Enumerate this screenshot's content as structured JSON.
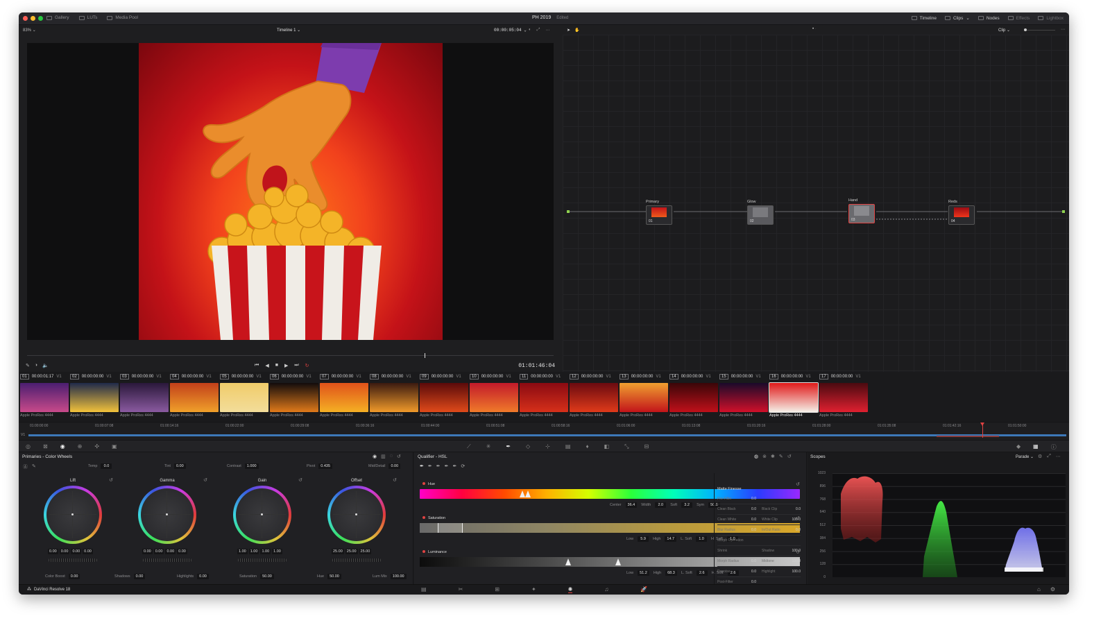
{
  "titlebar": {
    "left_items": [
      "Gallery",
      "LUTs",
      "Media Pool"
    ],
    "project_title": "PH 2019",
    "project_status": "Edited",
    "right_items": [
      {
        "label": "Timeline",
        "active": true
      },
      {
        "label": "Clips",
        "active": true
      },
      {
        "label": "Nodes",
        "active": true
      },
      {
        "label": "Effects",
        "active": false
      },
      {
        "label": "Lightbox",
        "active": false
      }
    ]
  },
  "viewer": {
    "zoom": "83%",
    "timeline_name": "Timeline 1",
    "source_timecode": "00:00:05:04",
    "record_timecode": "01:01:46:04"
  },
  "nodes_panel": {
    "mode": "Clip",
    "nodes": [
      {
        "label": "Primary",
        "num": "01"
      },
      {
        "label": "Glow",
        "num": "02"
      },
      {
        "label": "Hand",
        "num": "03"
      },
      {
        "label": "Reds",
        "num": "04"
      }
    ]
  },
  "clips": {
    "items": [
      {
        "num": "01",
        "tc": "00:00:01:17",
        "track": "V1",
        "label": "Apple ProRes 4444"
      },
      {
        "num": "02",
        "tc": "00:00:00:00",
        "track": "V1",
        "label": "Apple ProRes 4444"
      },
      {
        "num": "03",
        "tc": "00:00:00:00",
        "track": "V1",
        "label": "Apple ProRes 4444"
      },
      {
        "num": "04",
        "tc": "00:00:00:00",
        "track": "V1",
        "label": "Apple ProRes 4444"
      },
      {
        "num": "05",
        "tc": "00:00:00:00",
        "track": "V1",
        "label": "Apple ProRes 4444"
      },
      {
        "num": "06",
        "tc": "00:00:00:00",
        "track": "V1",
        "label": "Apple ProRes 4444"
      },
      {
        "num": "07",
        "tc": "00:00:00:00",
        "track": "V1",
        "label": "Apple ProRes 4444"
      },
      {
        "num": "08",
        "tc": "00:00:00:00",
        "track": "V1",
        "label": "Apple ProRes 4444"
      },
      {
        "num": "09",
        "tc": "00:00:00:00",
        "track": "V1",
        "label": "Apple ProRes 4444"
      },
      {
        "num": "10",
        "tc": "00:00:00:00",
        "track": "V1",
        "label": "Apple ProRes 4444"
      },
      {
        "num": "11",
        "tc": "00:00:00:00",
        "track": "V1",
        "label": "Apple ProRes 4444"
      },
      {
        "num": "12",
        "tc": "00:00:00:00",
        "track": "V1",
        "label": "Apple ProRes 4444"
      },
      {
        "num": "13",
        "tc": "00:00:00:00",
        "track": "V1",
        "label": "Apple ProRes 4444"
      },
      {
        "num": "14",
        "tc": "00:00:00:00",
        "track": "V1",
        "label": "Apple ProRes 4444"
      },
      {
        "num": "15",
        "tc": "00:00:00:00",
        "track": "V1",
        "label": "Apple ProRes 4444"
      },
      {
        "num": "16",
        "tc": "00:00:00:00",
        "track": "V1",
        "label": "Apple ProRes 4444"
      },
      {
        "num": "17",
        "tc": "00:00:00:00",
        "track": "V1",
        "label": "Apple ProRes 4444"
      }
    ],
    "track_label": "V1",
    "ruler_ticks": [
      "01:00:00:00",
      "01:00:07:08",
      "01:00:14:16",
      "01:00:22:00",
      "01:00:29:08",
      "01:00:36:16",
      "01:00:44:00",
      "01:00:51:08",
      "01:00:58:16",
      "01:01:06:00",
      "01:01:13:08",
      "01:01:20:16",
      "01:01:28:00",
      "01:01:35:08",
      "01:01:42:16",
      "01:01:50:00"
    ]
  },
  "primaries": {
    "title": "Primaries - Color Wheels",
    "top_params": [
      {
        "label": "Temp",
        "value": "0.0"
      },
      {
        "label": "Tint",
        "value": "0.00"
      },
      {
        "label": "Contrast",
        "value": "1.000"
      },
      {
        "label": "Pivot",
        "value": "0.435"
      },
      {
        "label": "Mid/Detail",
        "value": "0.00"
      }
    ],
    "wheels": [
      {
        "name": "Lift",
        "values": [
          "0.00",
          "0.00",
          "0.00",
          "0.00"
        ]
      },
      {
        "name": "Gamma",
        "values": [
          "0.00",
          "0.00",
          "0.00",
          "0.00"
        ]
      },
      {
        "name": "Gain",
        "values": [
          "1.00",
          "1.00",
          "1.00",
          "1.00"
        ]
      },
      {
        "name": "Offset",
        "values": [
          "25.00",
          "25.00",
          "25.00"
        ]
      }
    ],
    "bottom_params": [
      {
        "label": "Color Boost",
        "value": "0.00"
      },
      {
        "label": "Shadows",
        "value": "0.00"
      },
      {
        "label": "Highlights",
        "value": "0.00"
      },
      {
        "label": "Saturation",
        "value": "50.00"
      },
      {
        "label": "Hue",
        "value": "50.00"
      },
      {
        "label": "Lum Mix",
        "value": "100.00"
      }
    ]
  },
  "qualifier": {
    "title": "Qualifier - HSL",
    "hue": {
      "label": "Hue",
      "params": [
        {
          "label": "Center",
          "value": "36.4"
        },
        {
          "label": "Width",
          "value": "2.0"
        },
        {
          "label": "Soft",
          "value": "3.2"
        },
        {
          "label": "Sym",
          "value": "50.0"
        }
      ]
    },
    "saturation": {
      "label": "Saturation",
      "params": [
        {
          "label": "Low",
          "value": "5.9"
        },
        {
          "label": "High",
          "value": "14.7"
        },
        {
          "label": "L. Soft",
          "value": "1.0"
        },
        {
          "label": "H. Soft",
          "value": "1.0"
        }
      ]
    },
    "luminance": {
      "label": "Luminance",
      "params": [
        {
          "label": "Low",
          "value": "51.2"
        },
        {
          "label": "High",
          "value": "68.3"
        },
        {
          "label": "L. Soft",
          "value": "2.6"
        },
        {
          "label": "H. Soft",
          "value": "2.6"
        }
      ]
    },
    "matte_finesse": {
      "title": "Matte Finesse",
      "rows": [
        {
          "a": "Pre-Filter",
          "av": "0.0",
          "b": "",
          "bv": ""
        },
        {
          "a": "Clean Black",
          "av": "0.0",
          "b": "Black Clip",
          "bv": "0.0"
        },
        {
          "a": "Clean White",
          "av": "0.0",
          "b": "White Clip",
          "bv": "100.0"
        },
        {
          "a": "Blur Radius",
          "av": "0.0",
          "b": "In/Out Ratio",
          "bv": "0.0"
        },
        {
          "a": "Morph Operation",
          "av": "",
          "b": "",
          "bv": ""
        },
        {
          "a": "Shrink",
          "av": "",
          "b": "Shadow",
          "bv": "100.0"
        },
        {
          "a": "Morph Radius",
          "av": "0.0",
          "b": "Midtone",
          "bv": "100.0"
        },
        {
          "a": "Denoise",
          "av": "0.0",
          "b": "Highlight",
          "bv": "100.0"
        },
        {
          "a": "Post-Filter",
          "av": "0.0",
          "b": "",
          "bv": ""
        }
      ]
    }
  },
  "scopes": {
    "title": "Scopes",
    "mode": "Parade",
    "y_ticks": [
      "1023",
      "896",
      "768",
      "640",
      "512",
      "384",
      "256",
      "128",
      "0"
    ]
  },
  "statusbar": {
    "app_name": "DaVinci Resolve 18"
  },
  "colors": {
    "accent_red": "#e04242",
    "panel_bg": "#202023",
    "window_bg": "#1e1e20"
  }
}
